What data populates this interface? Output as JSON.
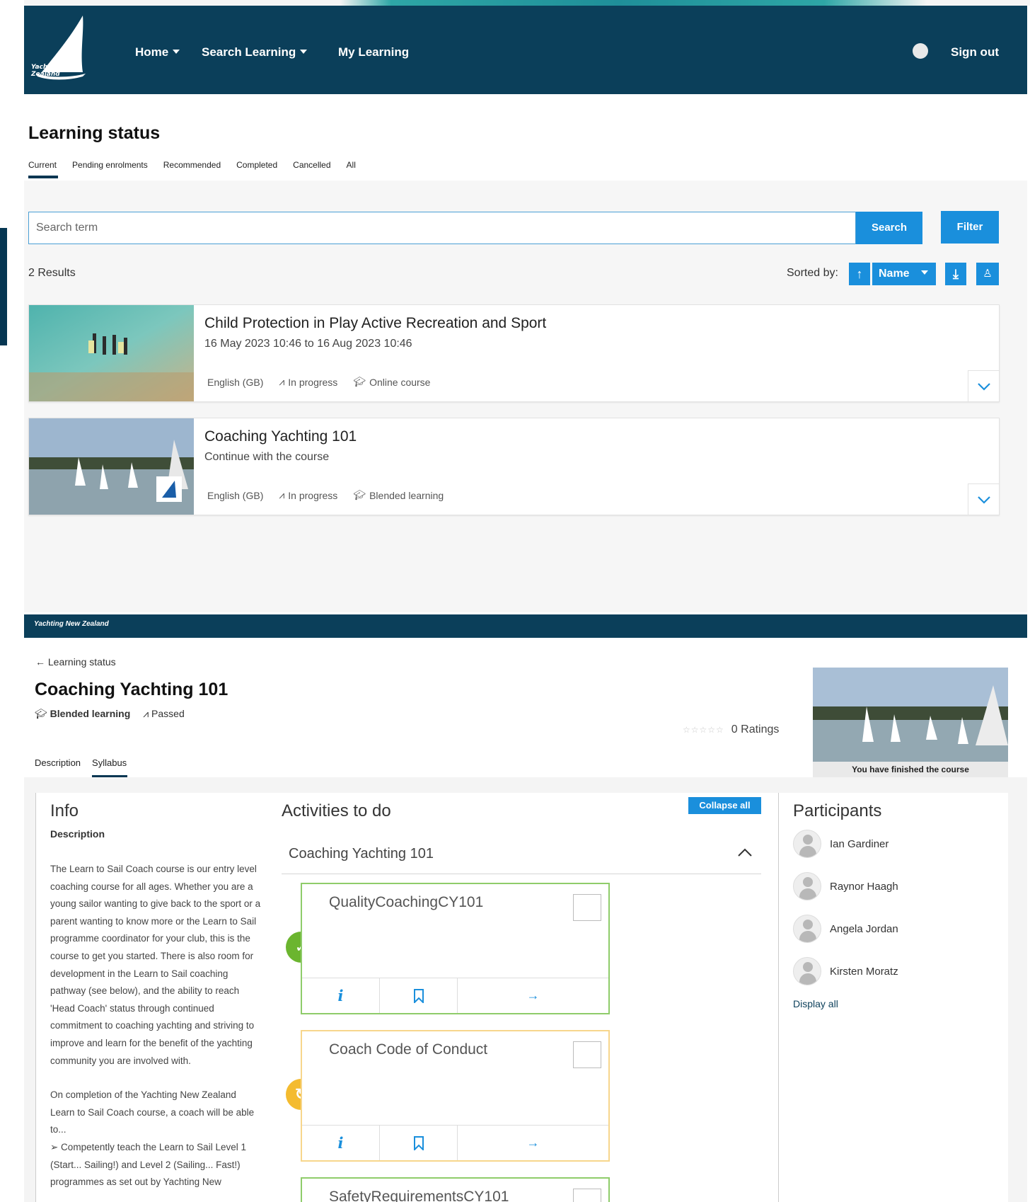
{
  "nav": {
    "brand": "Yachting New Zealand",
    "items": [
      {
        "label": "Home"
      },
      {
        "label": "Search Learning"
      },
      {
        "label": "My Learning"
      }
    ],
    "sign_out": "Sign out"
  },
  "learning_status": {
    "title": "Learning status",
    "tabs": [
      "Current",
      "Pending enrolments",
      "Recommended",
      "Completed",
      "Cancelled",
      "All"
    ],
    "search_placeholder": "Search term",
    "search_button": "Search",
    "filter_button": "Filter",
    "results_count": "2 Results",
    "sorted_by_label": "Sorted by:",
    "sort_value": "Name"
  },
  "courses": [
    {
      "title": "Child Protection in Play Active Recreation and Sport",
      "subtitle": "16 May 2023 10:46 to 16 Aug 2023 10:46",
      "language": "English (GB)",
      "status": "In progress",
      "type": "Online course"
    },
    {
      "title": "Coaching Yachting 101",
      "subtitle": "Continue with the course",
      "language": "English (GB)",
      "status": "In progress",
      "type": "Blended learning"
    }
  ],
  "footer": {
    "brand": "Yachting New Zealand"
  },
  "detail": {
    "back_label": "Learning status",
    "title": "Coaching Yachting 101",
    "type": "Blended learning",
    "status": "Passed",
    "ratings": "0 Ratings",
    "hero_caption": "You have finished the course",
    "tabs": [
      "Description",
      "Syllabus"
    ]
  },
  "info": {
    "title": "Info",
    "subtitle": "Description",
    "paragraphs": [
      "The Learn to Sail Coach course is our entry level coaching course for all ages. Whether you are a young sailor wanting to give back to the sport or a parent wanting to know more or the Learn to Sail programme coordinator for your club, this is the course to get you started. There is also room for development in the Learn to Sail coaching pathway (see below), and the ability to reach 'Head Coach' status through continued commitment to coaching yachting and striving to improve and learn for the benefit of the yachting community you are involved with.",
      "On completion of the Yachting New Zealand Learn to Sail Coach course, a coach will be able to...",
      "➢ Competently teach the Learn to Sail Level 1 (Start... Sailing!) and Level 2 (Sailing... Fast!) programmes as set out by Yachting New"
    ]
  },
  "activities": {
    "title": "Activities to do",
    "collapse_all": "Collapse all",
    "section": "Coaching Yachting 101",
    "items": [
      {
        "name": "QualityCoachingCY101",
        "state": "done"
      },
      {
        "name": "Coach Code of Conduct",
        "state": "in-progress"
      },
      {
        "name": "SafetyRequirementsCY101",
        "state": "none"
      }
    ],
    "colors": {
      "done": "#6bb52f",
      "in_progress": "#f4bb2f",
      "accent": "#1a8fdc",
      "navy": "#0b3f5a"
    }
  },
  "participants": {
    "title": "Participants",
    "people": [
      "Ian Gardiner",
      "Raynor Haagh",
      "Angela Jordan",
      "Kirsten Moratz"
    ],
    "display_all": "Display all"
  }
}
